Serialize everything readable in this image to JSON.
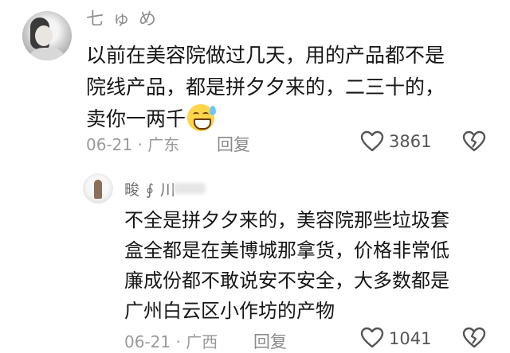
{
  "comments": [
    {
      "user_name": "七 ゅ め",
      "text_lines": [
        "以前在美容院做过几天，用的产品都不是",
        "院线产品，都是拼夕夕来的，二三十的，",
        "卖你一两千"
      ],
      "emoji_icon": "sweat-smile-emoji-icon",
      "date": "06-21",
      "location": "广东",
      "reply_label": "回复",
      "like_count": "3861"
    },
    {
      "user_name": "畯 ∮ 川",
      "text_lines": [
        "不全是拼夕夕来的，美容院那些垃圾套",
        "盒全都是在美博城那拿货，价格非常低",
        "廉成份都不敢说安不安全，大多数都是",
        "广州白云区小作坊的产物"
      ],
      "date": "06-21",
      "location": "广西",
      "reply_label": "回复",
      "like_count": "1041"
    }
  ],
  "meta_separator": "·",
  "colors": {
    "text": "#161616",
    "muted": "#9a9a9a",
    "icon": "#555555"
  }
}
